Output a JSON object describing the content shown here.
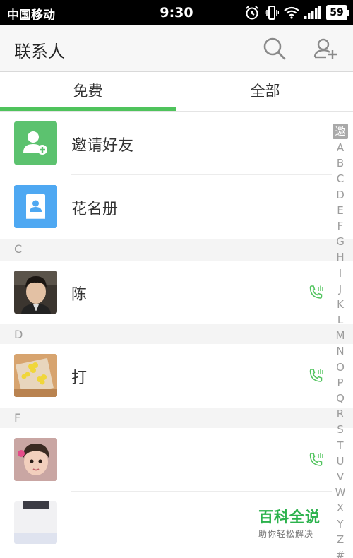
{
  "status_bar": {
    "carrier": "中国移动",
    "time": "9:30",
    "battery": "59"
  },
  "header": {
    "title": "联系人",
    "search_icon": "search-icon",
    "add_contact_icon": "add-person-icon"
  },
  "tabs": [
    {
      "label": "免费",
      "selected": true
    },
    {
      "label": "全部",
      "selected": false
    }
  ],
  "colors": {
    "accent": "#4fc35c",
    "invite_tile": "#5cc26f",
    "roster_tile": "#4ea8f2"
  },
  "contacts": {
    "invite": {
      "label": "邀请好友",
      "icon": "add-person-icon"
    },
    "roster": {
      "label": "花名册",
      "icon": "address-book-icon"
    },
    "sections": [
      {
        "letter": "C",
        "items": [
          {
            "name": "陈",
            "avatar": "man-portrait-photo",
            "icon": "phone-call-icon"
          }
        ]
      },
      {
        "letter": "D",
        "items": [
          {
            "name": "打",
            "avatar": "yellow-flowers-photo",
            "icon": "phone-call-icon"
          }
        ]
      },
      {
        "letter": "F",
        "items": [
          {
            "name": "",
            "avatar": "child-portrait-photo",
            "icon": "phone-call-icon"
          }
        ]
      }
    ]
  },
  "alpha_index": {
    "top": "邀",
    "letters": [
      "A",
      "B",
      "C",
      "D",
      "E",
      "F",
      "G",
      "H",
      "I",
      "J",
      "K",
      "L",
      "M",
      "N",
      "O",
      "P",
      "Q",
      "R",
      "S",
      "T",
      "U",
      "V",
      "W",
      "X",
      "Y",
      "Z",
      "#"
    ]
  },
  "watermark": {
    "title": "百科全说",
    "subtitle": "助你轻松解决"
  }
}
